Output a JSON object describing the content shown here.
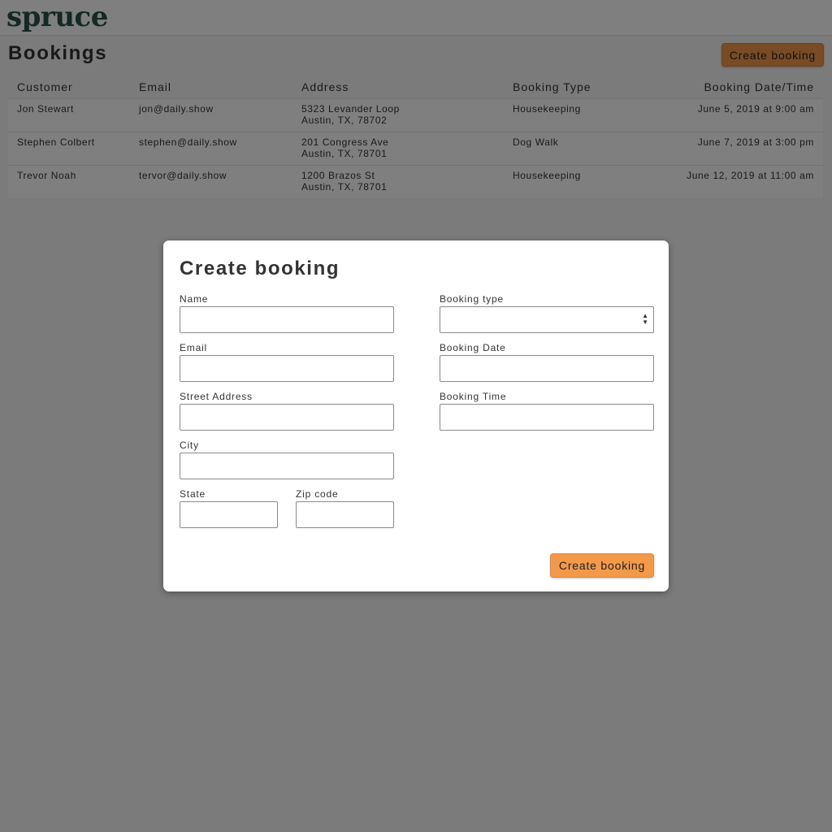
{
  "app": {
    "logo_text": "spruce",
    "brand_color": "#2a5148",
    "accent_color": "#f3994a"
  },
  "page": {
    "title": "Bookings",
    "create_button_label": "Create booking"
  },
  "table": {
    "headers": {
      "customer": "Customer",
      "email": "Email",
      "address": "Address",
      "booking_type": "Booking Type",
      "datetime": "Booking Date/Time"
    },
    "rows": [
      {
        "customer": "Jon Stewart",
        "email": "jon@daily.show",
        "address_line1": "5323 Levander Loop",
        "address_line2": "Austin, TX, 78702",
        "booking_type": "Housekeeping",
        "datetime": "June 5, 2019 at 9:00 am"
      },
      {
        "customer": "Stephen Colbert",
        "email": "stephen@daily.show",
        "address_line1": "201 Congress Ave",
        "address_line2": "Austin, TX, 78701",
        "booking_type": "Dog Walk",
        "datetime": "June 7, 2019 at 3:00 pm"
      },
      {
        "customer": "Trevor Noah",
        "email": "tervor@daily.show",
        "address_line1": "1200 Brazos St",
        "address_line2": "Austin, TX, 78701",
        "booking_type": "Housekeeping",
        "datetime": "June 12, 2019 at 11:00 am"
      }
    ]
  },
  "modal": {
    "title": "Create booking",
    "fields": {
      "name": {
        "label": "Name",
        "value": ""
      },
      "email": {
        "label": "Email",
        "value": ""
      },
      "street": {
        "label": "Street Address",
        "value": ""
      },
      "city": {
        "label": "City",
        "value": ""
      },
      "state": {
        "label": "State",
        "value": ""
      },
      "zip": {
        "label": "Zip code",
        "value": ""
      },
      "booking_type": {
        "label": "Booking type",
        "value": ""
      },
      "booking_date": {
        "label": "Booking Date",
        "value": ""
      },
      "booking_time": {
        "label": "Booking Time",
        "value": ""
      }
    },
    "submit_label": "Create booking"
  }
}
